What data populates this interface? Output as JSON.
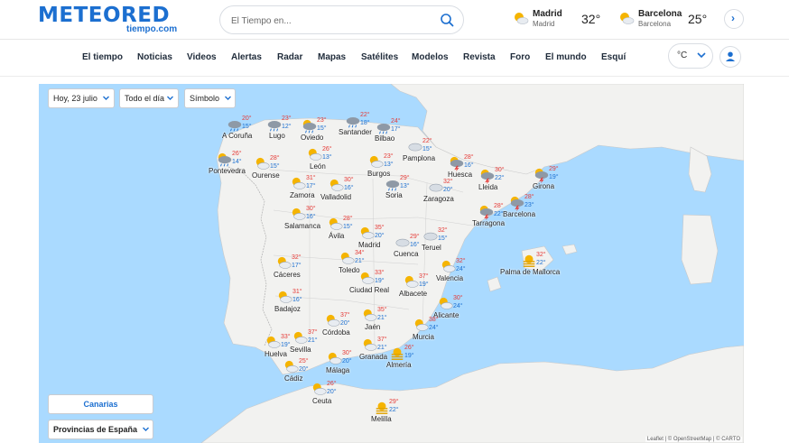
{
  "header": {
    "logo_main": "METEORED",
    "logo_sub": "tiempo.com",
    "search_placeholder": "El Tiempo en...",
    "cities": [
      {
        "name": "Madrid",
        "sub": "Madrid",
        "temp": "32°"
      },
      {
        "name": "Barcelona",
        "sub": "Barcelona",
        "temp": "25°"
      }
    ]
  },
  "nav": {
    "items": [
      "El tiempo",
      "Noticias",
      "Videos",
      "Alertas",
      "Radar",
      "Mapas",
      "Satélites",
      "Modelos",
      "Revista",
      "Foro",
      "El mundo",
      "Esquí"
    ],
    "unit": "°C"
  },
  "map": {
    "controls": {
      "date": "Hoy, 23 julio",
      "period": "Todo el día",
      "type": "Símbolo"
    },
    "canarias": "Canarias",
    "provinces": "Provincias de España",
    "attribution": "Leaflet | © OpenStreetMap | © CARTO",
    "colors": {
      "sea": "#aadaff",
      "land": "#f2f2f0",
      "max": "#e53935",
      "min": "#1c6fd0"
    },
    "markers": [
      {
        "name": "A Coruña",
        "max": "20°",
        "min": "15°",
        "icon": "rain-cloud-icon"
      },
      {
        "name": "Lugo",
        "max": "23°",
        "min": "12°",
        "icon": "rain-cloud-icon"
      },
      {
        "name": "Oviedo",
        "max": "23°",
        "min": "15°",
        "icon": "rain-sun-icon"
      },
      {
        "name": "Santander",
        "max": "22°",
        "min": "18°",
        "icon": "rain-cloud-icon"
      },
      {
        "name": "Bilbao",
        "max": "24°",
        "min": "17°",
        "icon": "rain-cloud-icon"
      },
      {
        "name": "Pontevedra",
        "max": "26°",
        "min": "14°",
        "icon": "rain-sun-icon"
      },
      {
        "name": "Ourense",
        "max": "28°",
        "min": "15°",
        "icon": "sun-cloud-icon"
      },
      {
        "name": "León",
        "max": "26°",
        "min": "13°",
        "icon": "sun-cloud-icon"
      },
      {
        "name": "Burgos",
        "max": "23°",
        "min": "13°",
        "icon": "sun-cloud-icon"
      },
      {
        "name": "Pamplona",
        "max": "22°",
        "min": "15°",
        "icon": "cloud-icon"
      },
      {
        "name": "Huesca",
        "max": "28°",
        "min": "16°",
        "icon": "storm-icon"
      },
      {
        "name": "Lleida",
        "max": "30°",
        "min": "22°",
        "icon": "storm-icon"
      },
      {
        "name": "Girona",
        "max": "29°",
        "min": "19°",
        "icon": "storm-icon"
      },
      {
        "name": "Zamora",
        "max": "31°",
        "min": "17°",
        "icon": "sun-cloud-icon"
      },
      {
        "name": "Valladolid",
        "max": "30°",
        "min": "16°",
        "icon": "sun-cloud-icon"
      },
      {
        "name": "Soria",
        "max": "29°",
        "min": "13°",
        "icon": "rain-cloud-icon"
      },
      {
        "name": "Zaragoza",
        "max": "32°",
        "min": "20°",
        "icon": "cloud-icon"
      },
      {
        "name": "Barcelona",
        "max": "28°",
        "min": "23°",
        "icon": "storm-icon"
      },
      {
        "name": "Tarragona",
        "max": "28°",
        "min": "22°",
        "icon": "storm-icon"
      },
      {
        "name": "Salamanca",
        "max": "30°",
        "min": "16°",
        "icon": "sun-cloud-icon"
      },
      {
        "name": "Ávila",
        "max": "28°",
        "min": "15°",
        "icon": "sun-cloud-icon"
      },
      {
        "name": "Madrid",
        "max": "35°",
        "min": "20°",
        "icon": "sun-cloud-icon"
      },
      {
        "name": "Cuenca",
        "max": "29°",
        "min": "16°",
        "icon": "cloud-icon"
      },
      {
        "name": "Teruel",
        "max": "32°",
        "min": "15°",
        "icon": "cloud-icon"
      },
      {
        "name": "Cáceres",
        "max": "32°",
        "min": "17°",
        "icon": "sun-cloud-icon"
      },
      {
        "name": "Toledo",
        "max": "34°",
        "min": "21°",
        "icon": "sun-cloud-icon"
      },
      {
        "name": "Valencia",
        "max": "32°",
        "min": "24°",
        "icon": "sun-cloud-icon"
      },
      {
        "name": "Palma de Mallorca",
        "max": "32°",
        "min": "22°",
        "icon": "haze-icon"
      },
      {
        "name": "Badajoz",
        "max": "31°",
        "min": "16°",
        "icon": "sun-cloud-icon"
      },
      {
        "name": "Ciudad Real",
        "max": "33°",
        "min": "19°",
        "icon": "sun-cloud-icon"
      },
      {
        "name": "Albacete",
        "max": "37°",
        "min": "19°",
        "icon": "sun-cloud-icon"
      },
      {
        "name": "Alicante",
        "max": "30°",
        "min": "24°",
        "icon": "sun-cloud-icon"
      },
      {
        "name": "Córdoba",
        "max": "37°",
        "min": "20°",
        "icon": "sun-cloud-icon"
      },
      {
        "name": "Jaén",
        "max": "35°",
        "min": "21°",
        "icon": "sun-cloud-icon"
      },
      {
        "name": "Murcia",
        "max": "38°",
        "min": "24°",
        "icon": "sun-cloud-icon"
      },
      {
        "name": "Huelva",
        "max": "33°",
        "min": "19°",
        "icon": "sun-cloud-icon"
      },
      {
        "name": "Sevilla",
        "max": "37°",
        "min": "21°",
        "icon": "sun-cloud-icon"
      },
      {
        "name": "Granada",
        "max": "37°",
        "min": "21°",
        "icon": "sun-cloud-icon"
      },
      {
        "name": "Almería",
        "max": "26°",
        "min": "19°",
        "icon": "haze-icon"
      },
      {
        "name": "Cádiz",
        "max": "25°",
        "min": "20°",
        "icon": "sun-cloud-icon"
      },
      {
        "name": "Málaga",
        "max": "30°",
        "min": "20°",
        "icon": "sun-cloud-icon"
      },
      {
        "name": "Ceuta",
        "max": "26°",
        "min": "20°",
        "icon": "sun-cloud-icon"
      },
      {
        "name": "Melilla",
        "max": "29°",
        "min": "22°",
        "icon": "haze-icon"
      }
    ]
  }
}
